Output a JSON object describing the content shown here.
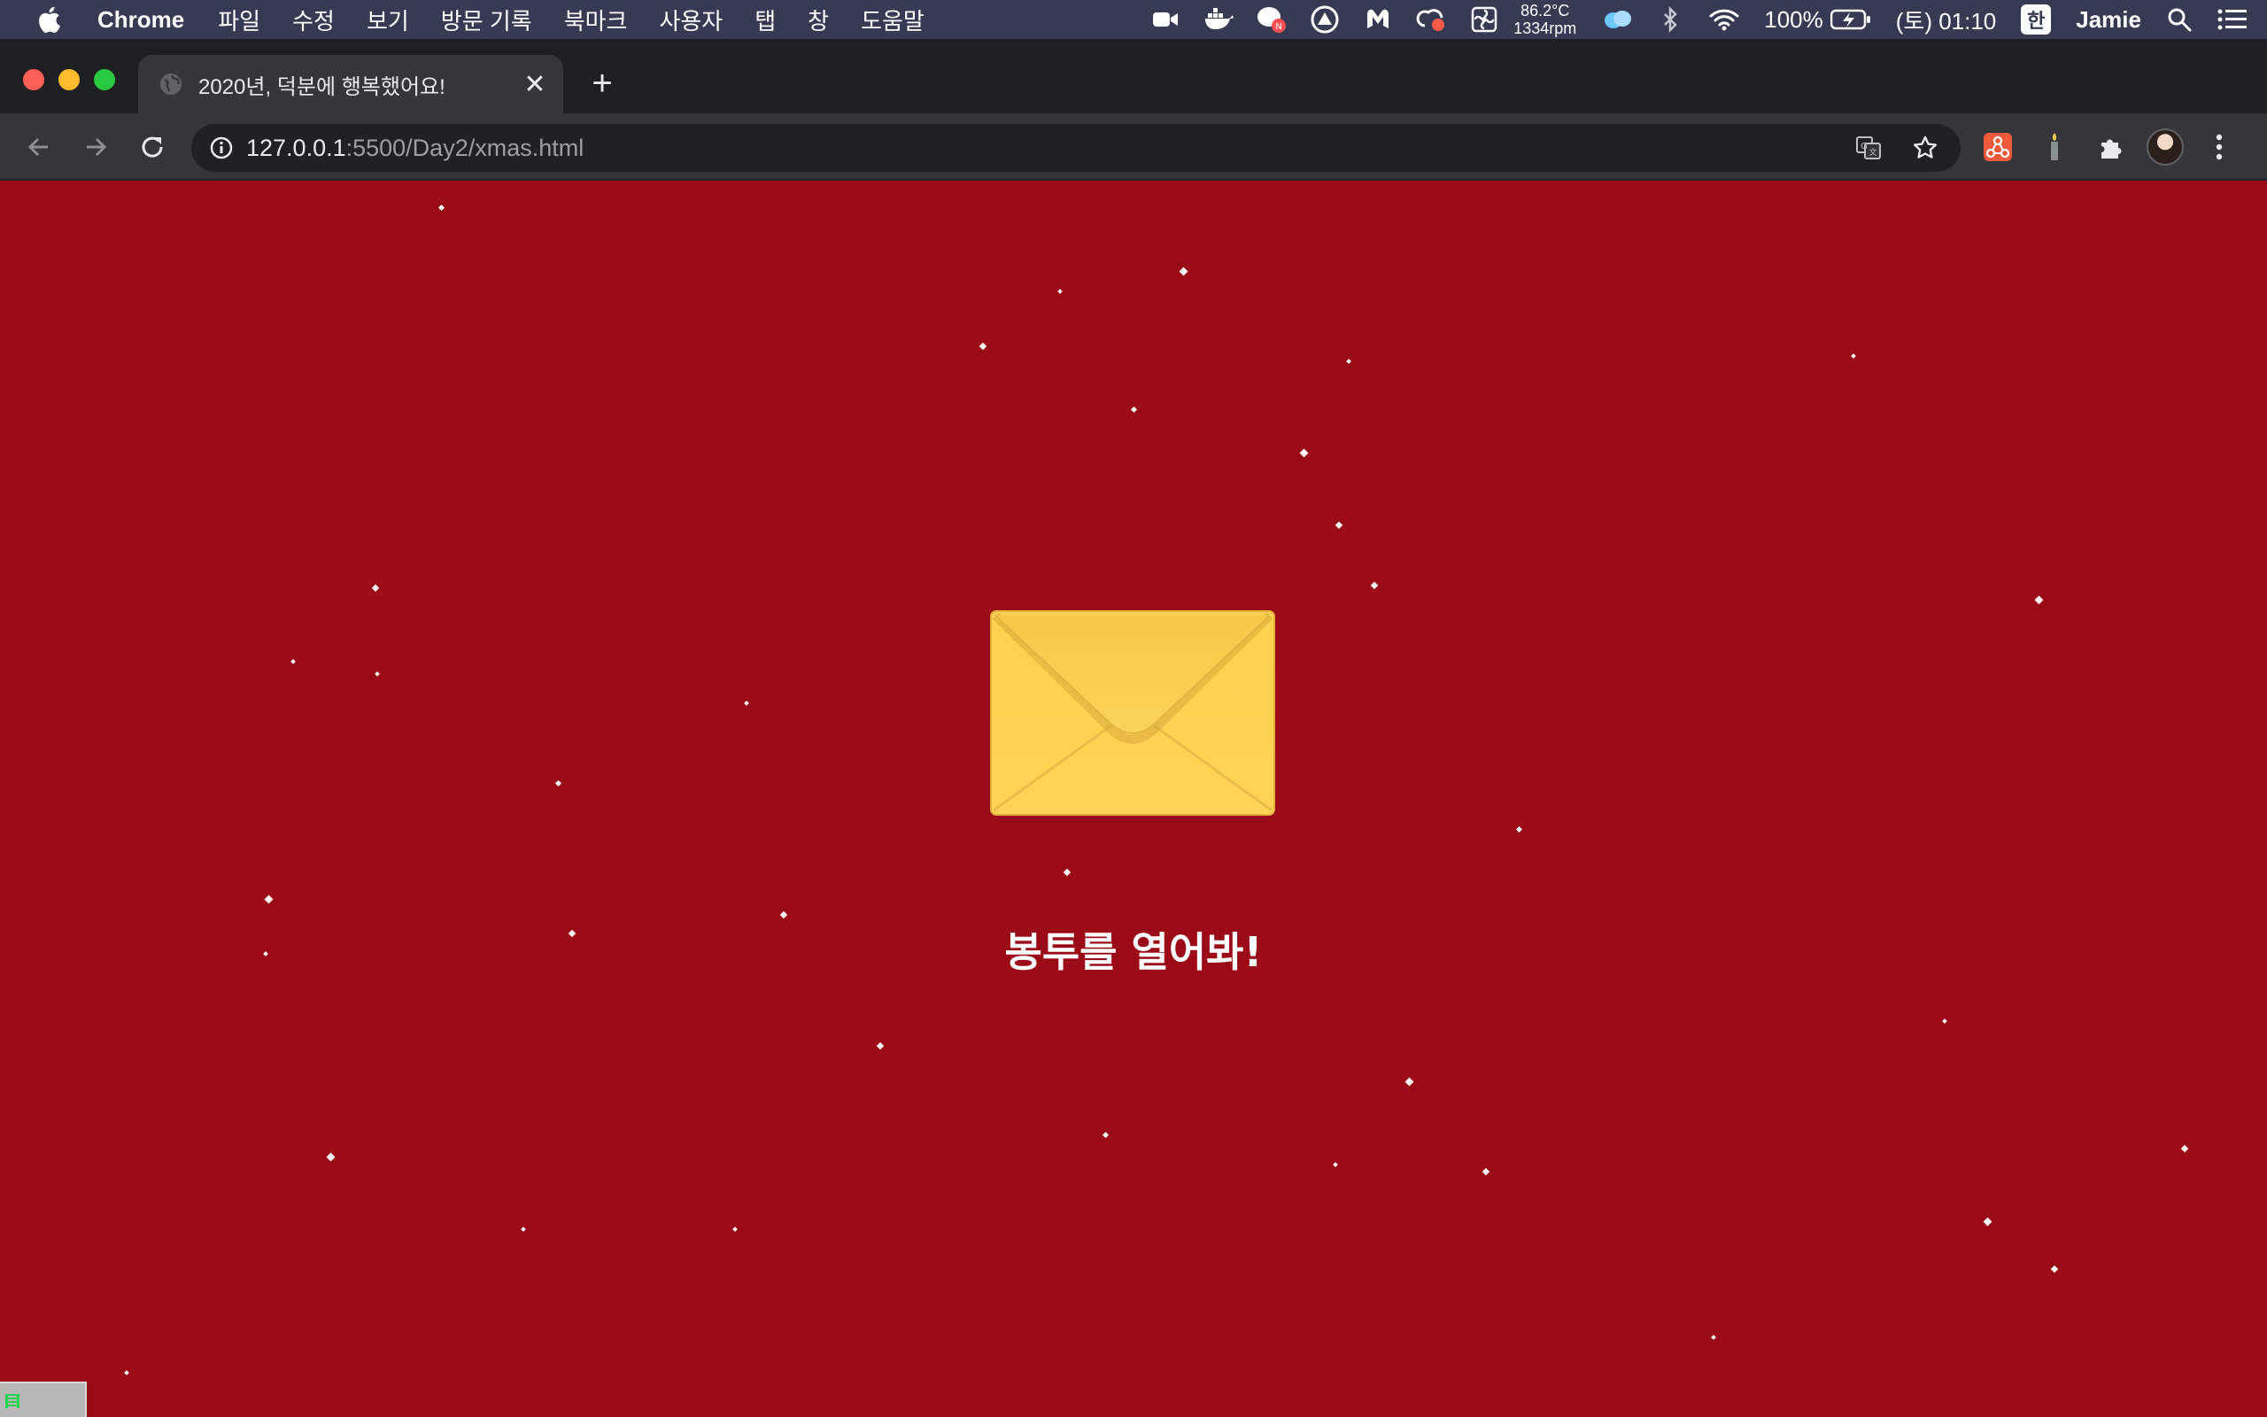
{
  "menubar": {
    "app_name": "Chrome",
    "menus": [
      "파일",
      "수정",
      "보기",
      "방문 기록",
      "북마크",
      "사용자",
      "탭",
      "창",
      "도움말"
    ],
    "temperature": "86.2°C",
    "fan_speed": "1334rpm",
    "battery": "100%",
    "clock": "(토) 01:10",
    "input_method": "한",
    "user": "Jamie"
  },
  "browser": {
    "tab_title": "2020년, 덕분에 행복했어요!",
    "new_tab_label": "+",
    "close_tab_label": "✕",
    "url_host": "127.0.0.1",
    "url_path": ":5500/Day2/xmas.html"
  },
  "page": {
    "caption": "봉투를 열어봐!",
    "background_color": "#9a0b17",
    "envelope_color": "#fbd155",
    "snow_color": "#ffffff"
  },
  "icons": {
    "apple": "apple-icon",
    "envelope": "envelope-icon",
    "snowflake": "snowflake-icon"
  }
}
